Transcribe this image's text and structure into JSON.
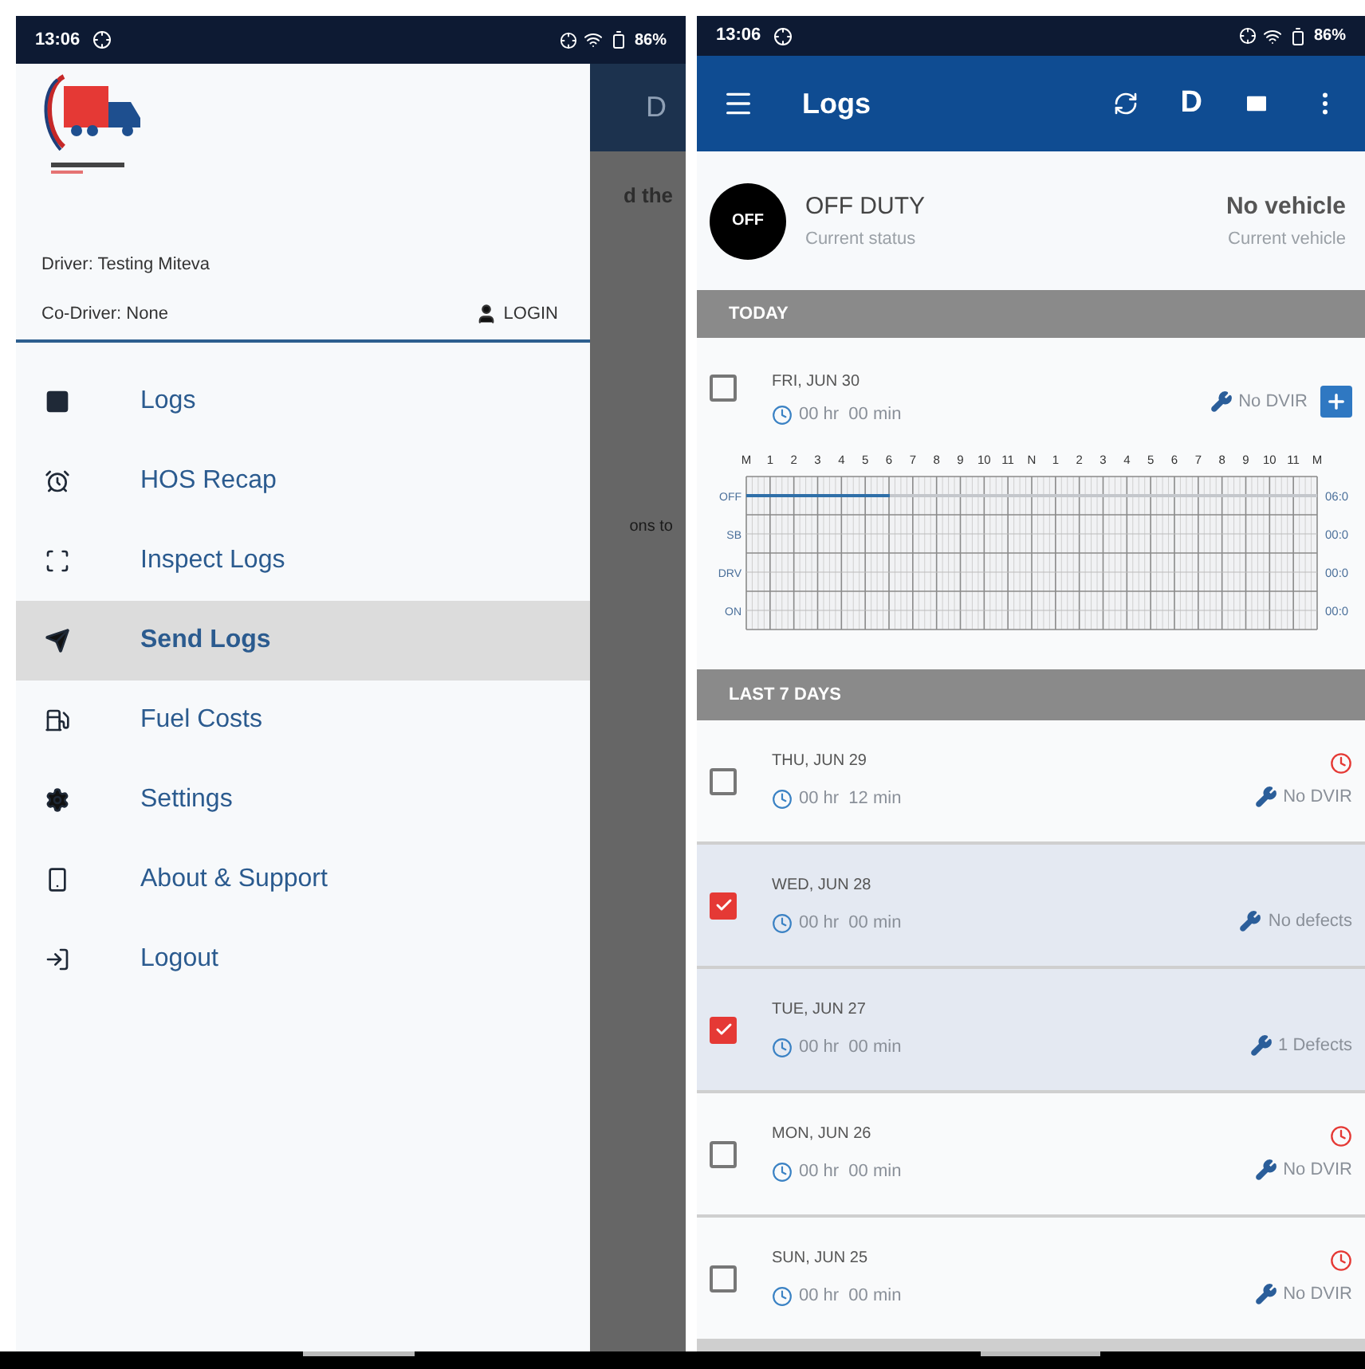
{
  "left_screen": {
    "status_bar": {
      "time": "13:06",
      "battery": "86%"
    },
    "drawer": {
      "driver": "Driver: Testing Miteva",
      "co_driver": "Co-Driver: None",
      "login": "LOGIN",
      "items": [
        {
          "label": "Logs",
          "selected": false
        },
        {
          "label": "HOS Recap",
          "selected": false
        },
        {
          "label": "Inspect Logs",
          "selected": false
        },
        {
          "label": "Send Logs",
          "selected": true
        },
        {
          "label": "Fuel Costs",
          "selected": false
        },
        {
          "label": "Settings",
          "selected": false
        },
        {
          "label": "About & Support",
          "selected": false
        },
        {
          "label": "Logout",
          "selected": false
        }
      ]
    },
    "background": {
      "app_bar_letter": "D",
      "text_fragments": [
        "d the",
        "ons to"
      ]
    }
  },
  "right_screen": {
    "status_bar": {
      "time": "13:06",
      "battery": "86%"
    },
    "app_bar": {
      "title": "Logs",
      "duty_letter": "D"
    },
    "status": {
      "badge": "OFF",
      "duty": "OFF DUTY",
      "duty_caption": "Current status",
      "vehicle": "No vehicle",
      "vehicle_caption": "Current vehicle"
    },
    "today": {
      "header": "TODAY",
      "log": {
        "date": "FRI, JUN 30",
        "duration": "00 hr  00 min",
        "checked": false,
        "dvir": "No DVIR"
      },
      "duty_graph": {
        "hour_labels": [
          "M",
          "1",
          "2",
          "3",
          "4",
          "5",
          "6",
          "7",
          "8",
          "9",
          "10",
          "11",
          "N",
          "1",
          "2",
          "3",
          "4",
          "5",
          "6",
          "7",
          "8",
          "9",
          "10",
          "11",
          "M"
        ],
        "rows": [
          {
            "label": "OFF",
            "total": "06:0",
            "level": 0.25
          },
          {
            "label": "SB",
            "total": "00:0",
            "level": 0
          },
          {
            "label": "DRV",
            "total": "00:0",
            "level": 0
          },
          {
            "label": "ON",
            "total": "00:0",
            "level": 0
          }
        ]
      }
    },
    "last_7_days": {
      "header": "LAST 7 DAYS",
      "logs": [
        {
          "date": "THU, JUN 29",
          "duration": "00 hr  12 min",
          "checked": false,
          "warning": true,
          "dvir": "No DVIR"
        },
        {
          "date": "WED, JUN 28",
          "duration": "00 hr  00 min",
          "checked": true,
          "warning": false,
          "dvir": "No defects"
        },
        {
          "date": "TUE, JUN 27",
          "duration": "00 hr  00 min",
          "checked": true,
          "warning": false,
          "dvir": "1 Defects"
        },
        {
          "date": "MON, JUN 26",
          "duration": "00 hr  00 min",
          "checked": false,
          "warning": true,
          "dvir": "No DVIR"
        },
        {
          "date": "SUN, JUN 25",
          "duration": "00 hr  00 min",
          "checked": false,
          "warning": true,
          "dvir": "No DVIR"
        }
      ]
    }
  }
}
